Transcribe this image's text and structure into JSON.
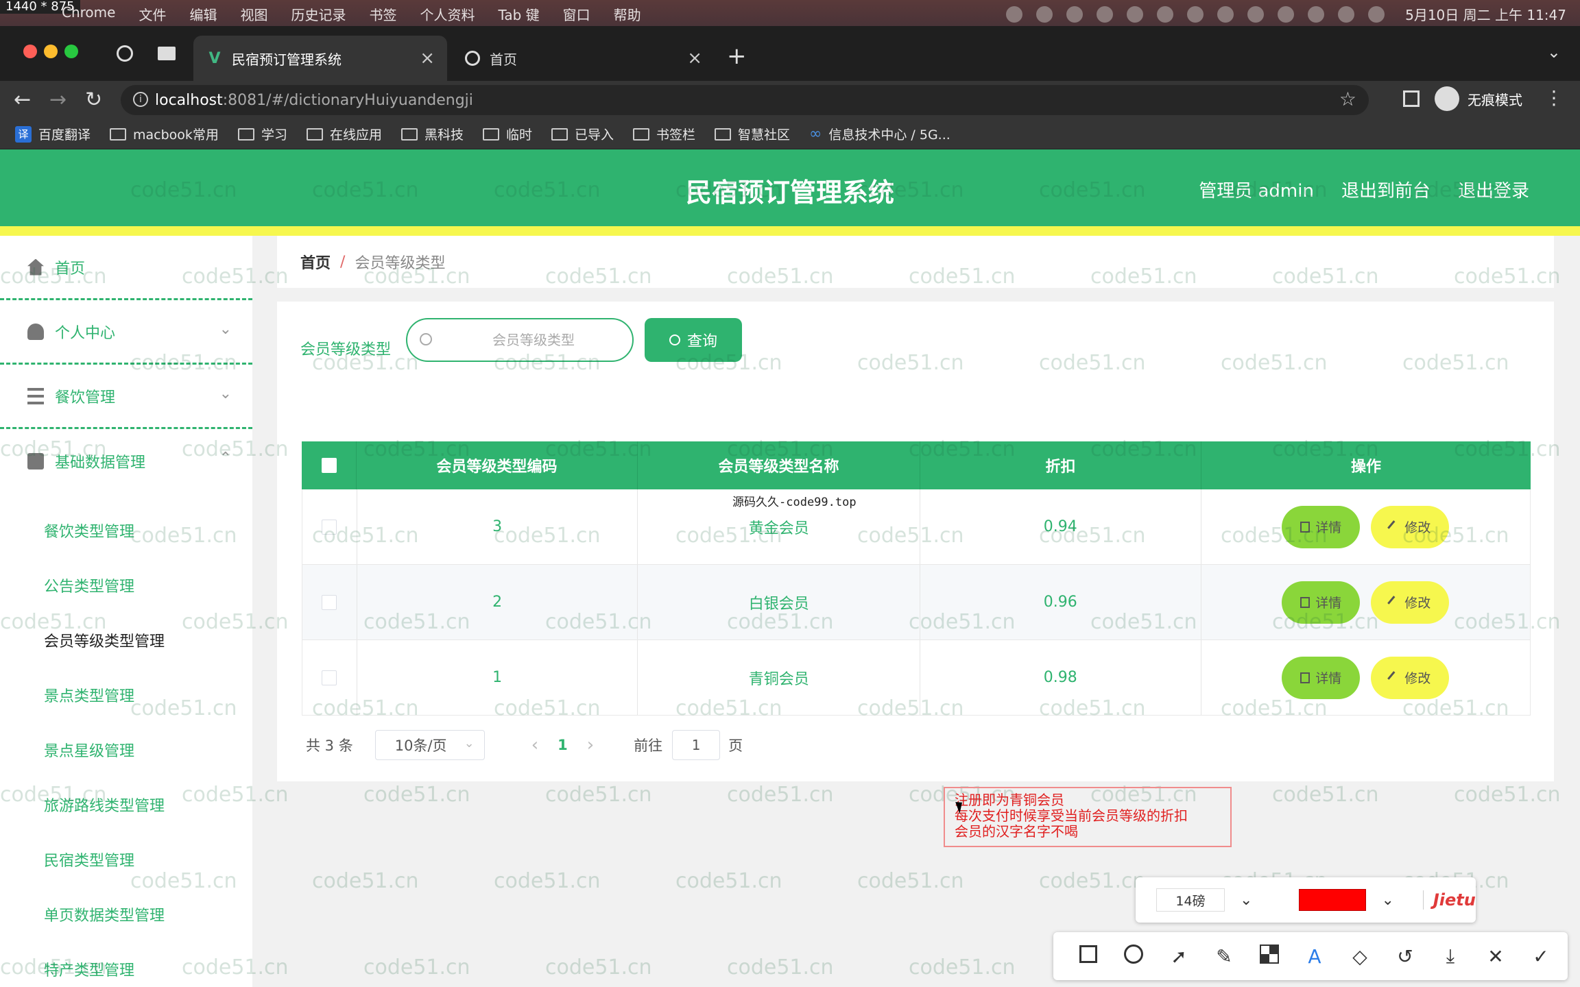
{
  "menubar": {
    "dims": "1440 * 875",
    "menus": [
      "Chrome",
      "文件",
      "编辑",
      "视图",
      "历史记录",
      "书签",
      "个人资料",
      "Tab 键",
      "窗口",
      "帮助"
    ],
    "clock": "5月10日 周二 上午 11:47"
  },
  "browser": {
    "tabs": [
      {
        "title": "民宿预订管理系统",
        "icon": "vue-icon"
      },
      {
        "title": "首页",
        "icon": "globe-icon"
      }
    ],
    "url_host": "localhost",
    "url_path": ":8081/#/dictionaryHuiyuandengji",
    "incognito_label": "无痕模式",
    "bookmarks": [
      "百度翻译",
      "macbook常用",
      "学习",
      "在线应用",
      "黑科技",
      "临时",
      "已导入",
      "书签栏",
      "智慧社区",
      "信息技术中心 / 5G..."
    ],
    "bookmark_badge": "译"
  },
  "header": {
    "title": "民宿预订管理系统",
    "admin": "管理员 admin",
    "to_front": "退出到前台",
    "logout": "退出登录",
    "accent": "#2fb36f",
    "stripe": "#f6f74e"
  },
  "sidebar": {
    "home": "首页",
    "personal": "个人中心",
    "catering": "餐饮管理",
    "basic": "基础数据管理",
    "sub_items": [
      "餐饮类型管理",
      "公告类型管理",
      "会员等级类型管理",
      "景点类型管理",
      "景点星级管理",
      "旅游路线类型管理",
      "民宿类型管理",
      "单页数据类型管理",
      "特产类型管理"
    ]
  },
  "breadcrumb": {
    "home": "首页",
    "separator": "/",
    "current": "会员等级类型"
  },
  "search": {
    "label": "会员等级类型",
    "placeholder": "会员等级类型",
    "button": "查询"
  },
  "table": {
    "headers": [
      "会员等级类型编码",
      "会员等级类型名称",
      "折扣",
      "操作"
    ],
    "rows": [
      {
        "code": "3",
        "name": "黄金会员",
        "discount": "0.94"
      },
      {
        "code": "2",
        "name": "白银会员",
        "discount": "0.96"
      },
      {
        "code": "1",
        "name": "青铜会员",
        "discount": "0.98"
      }
    ],
    "detail_label": "详情",
    "edit_label": "修改"
  },
  "pager": {
    "total": "共 3 条",
    "page_size": "10条/页",
    "current": "1",
    "goto": "前往",
    "goto_value": "1",
    "unit": "页"
  },
  "overlay_text": "源码久久-code99.top",
  "watermark": "code51.cn",
  "note": {
    "line1": "注册即为青铜会员",
    "line2": "每次支付时候享受当前会员等级的折扣",
    "line3": "会员的汉字名字不喝"
  },
  "jietu": {
    "font_size": "14磅",
    "brand": "Jietu",
    "color": "#ff0000"
  }
}
